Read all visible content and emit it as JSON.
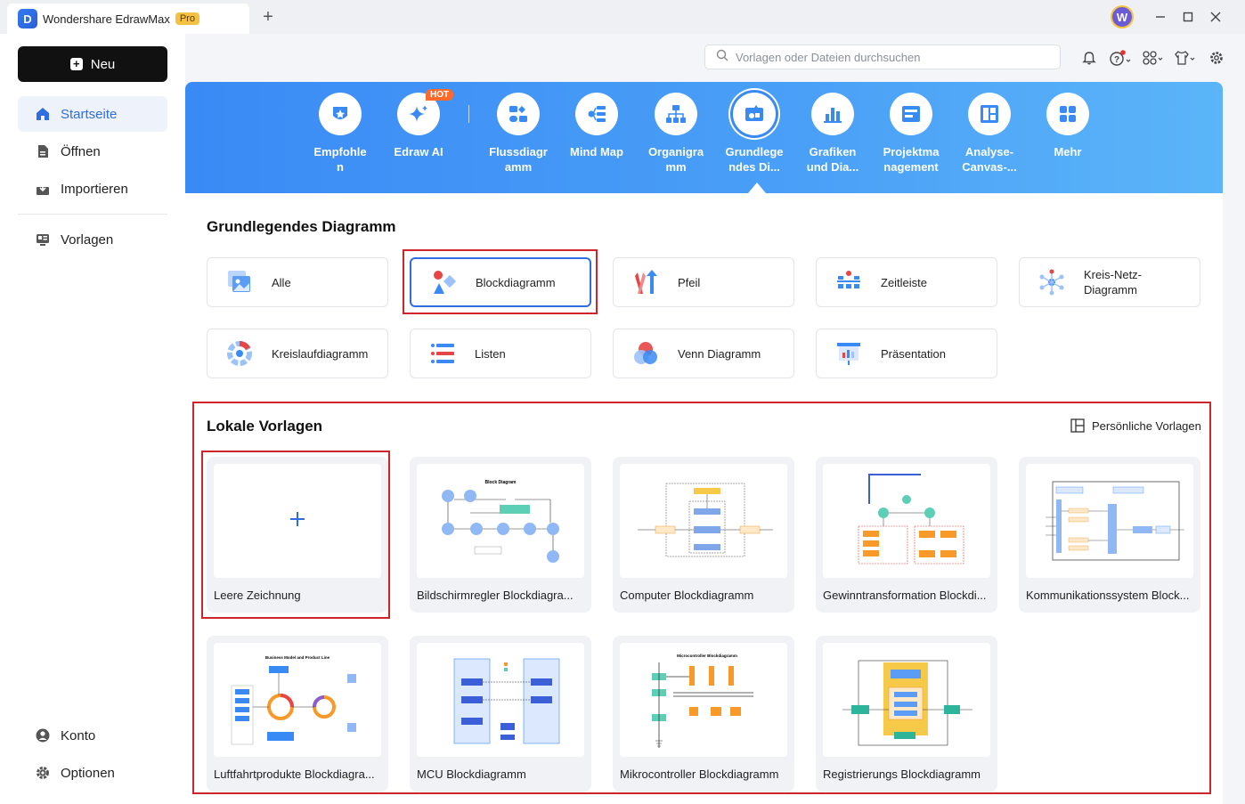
{
  "window": {
    "app_title": "Wondershare EdrawMax",
    "badge": "Pro",
    "new_tab": "+",
    "avatar_initial": "W"
  },
  "sidebar": {
    "new_button": "Neu",
    "items": [
      {
        "label": "Startseite",
        "icon": "home-icon",
        "active": true
      },
      {
        "label": "Öffnen",
        "icon": "file-icon"
      },
      {
        "label": "Importieren",
        "icon": "import-icon"
      },
      {
        "label": "Vorlagen",
        "icon": "templates-icon"
      }
    ],
    "bottom_items": [
      {
        "label": "Konto",
        "icon": "account-icon"
      },
      {
        "label": "Optionen",
        "icon": "gear-icon"
      }
    ]
  },
  "search": {
    "placeholder": "Vorlagen oder Dateien durchsuchen"
  },
  "categories": [
    {
      "label": "Empfohle\nn",
      "icon": "recommended-icon"
    },
    {
      "label": "Edraw AI",
      "icon": "ai-sparkle-icon",
      "badge": "HOT"
    },
    {
      "label": "Flussdiagr\namm",
      "icon": "flowchart-icon"
    },
    {
      "label": "Mind Map",
      "icon": "mindmap-icon"
    },
    {
      "label": "Organigra\nmm",
      "icon": "org-chart-icon"
    },
    {
      "label": "Grundlege\nndes Di...",
      "icon": "basic-diagram-icon",
      "active": true
    },
    {
      "label": "Grafiken\nund Dia...",
      "icon": "charts-icon"
    },
    {
      "label": "Projektma\nnagement",
      "icon": "project-icon"
    },
    {
      "label": "Analyse-\nCanvas-...",
      "icon": "canvas-icon"
    },
    {
      "label": "Mehr",
      "icon": "more-icon"
    }
  ],
  "section_basic": {
    "title": "Grundlegendes Diagramm",
    "types": [
      {
        "label": "Alle",
        "icon": "all-icon"
      },
      {
        "label": "Blockdiagramm",
        "icon": "block-diagram-icon",
        "selected": true
      },
      {
        "label": "Pfeil",
        "icon": "arrow-icon"
      },
      {
        "label": "Zeitleiste",
        "icon": "timeline-icon"
      },
      {
        "label": "Kreis-Netz-\nDiagramm",
        "icon": "circle-network-icon"
      },
      {
        "label": "Kreislaufdiagramm",
        "icon": "cycle-icon"
      },
      {
        "label": "Listen",
        "icon": "list-icon"
      },
      {
        "label": "Venn Diagramm",
        "icon": "venn-icon"
      },
      {
        "label": "Präsentation",
        "icon": "presentation-icon"
      }
    ]
  },
  "section_local": {
    "title": "Lokale Vorlagen",
    "personal_button": "Persönliche Vorlagen",
    "blank": {
      "label": "Leere Zeichnung",
      "icon": "plus-icon"
    },
    "templates": [
      {
        "label": "Bildschirmregler Blockdiagra..."
      },
      {
        "label": "Computer Blockdiagramm"
      },
      {
        "label": "Gewinntransformation Blockdi..."
      },
      {
        "label": "Kommunikationssystem Block..."
      },
      {
        "label": "Luftfahrtprodukte Blockdiagra..."
      },
      {
        "label": "MCU Blockdiagramm"
      },
      {
        "label": "Mikrocontroller Blockdiagramm"
      },
      {
        "label": "Registrierungs Blockdiagramm"
      }
    ],
    "thumb_titles": {
      "bildschirm": "Block Diagram",
      "luftfahrt": "Business Model and Product Line",
      "mikro": "Microcontroller Blockdiagramm"
    }
  },
  "colors": {
    "accent": "#2f6de1",
    "banner": "#3a8af5",
    "highlight": "#d0242b"
  }
}
